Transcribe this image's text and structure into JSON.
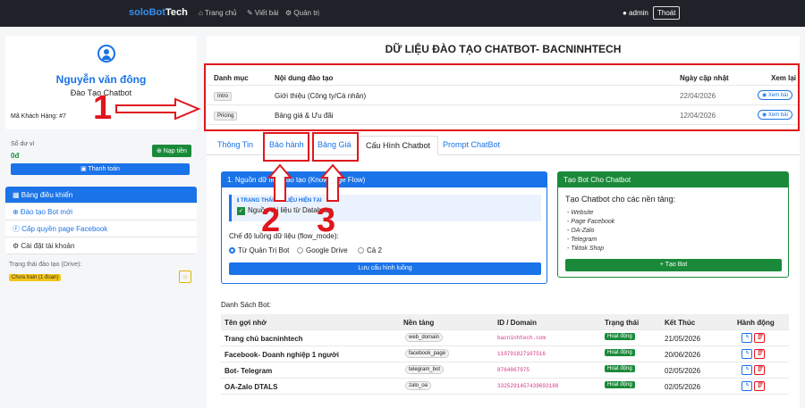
{
  "nav": {
    "logo_a": "soloBot",
    "logo_b": "Tech",
    "home": "⌂ Trang chủ",
    "posts": "✎ Viết bài",
    "admin": "⚙ Quản trị",
    "user": "● admin",
    "logout": "Thoát"
  },
  "profile": {
    "name": "Nguyễn văn đông",
    "role": "Đào Tạo Chatbot",
    "code": "Mã Khách Hàng: #7"
  },
  "balance": {
    "label": "Số dư ví",
    "value": "0đ",
    "topup": "⊕ Nạp tiền",
    "pay": "▣ Thanh toán"
  },
  "menu": [
    {
      "label": "▦ Bảng điều khiển"
    },
    {
      "label": "⊕ Đào tạo Bot mới"
    },
    {
      "label": "ⓕ Cấp quyền page Facebook"
    },
    {
      "label": "⚙ Cài đặt tài khoản"
    }
  ],
  "training": {
    "label": "Trạng thái đào tạo (Drive):",
    "badge": "Chưa train (1 đoạn)"
  },
  "main": {
    "title": "DỮ LIỆU ĐÀO TẠO CHATBOT- BACNINHTECH"
  },
  "train_table": {
    "headers": [
      "Danh mục",
      "Nội dung đào tạo",
      "Ngày cập nhật",
      "Xem lại"
    ],
    "rows": [
      {
        "tag": "Intro",
        "content": "Giới thiệu (Công ty/Cá nhân)",
        "date": "22/04/2026",
        "view": "◉ Xem bài"
      },
      {
        "tag": "Pricing",
        "content": "Bảng giá & Ưu đãi",
        "date": "12/04/2026",
        "view": "◉ Xem bài"
      }
    ]
  },
  "tabs": [
    "Thông Tin",
    "Bảo hành",
    "Bảng Giá",
    "Cấu Hình Chatbot",
    "Prompt ChatBot"
  ],
  "panel1": {
    "head": "1. Nguồn dữ liệu đào tạo (Knowledge Flow)",
    "status_title": "ℹ TRẠNG THÁI DỮ LIỆU HIỆN TẠI",
    "status_value": "Nguồn tài liệu từ Database",
    "mode_label": "Chế độ luồng dữ liệu (flow_mode):",
    "radios": [
      "Từ Quản Trị Bot",
      "Google Drive",
      "Cả 2"
    ],
    "save": "Lưu cấu hình luồng"
  },
  "panel2": {
    "head": "Tạo Bot Cho Chatbot",
    "title": "Tạo Chatbot cho các nền tảng:",
    "platforms": [
      "- Website",
      "- Page Facebook",
      "- OA-Zalo",
      "- Telegram",
      "- Tiktok Shop"
    ],
    "button": "+ Tạo Bot"
  },
  "bots": {
    "label": "Danh Sách Bot:",
    "headers": [
      "Tên gợi nhớ",
      "Nền tảng",
      "ID / Domain",
      "Trạng thái",
      "Kết Thúc",
      "Hành động"
    ],
    "rows": [
      {
        "name": "Trang chủ bacninhtech",
        "platform": "web_domain",
        "id": "bacninhtech.com",
        "status": "Hoạt động",
        "end": "21/05/2026"
      },
      {
        "name": "Facebook- Doanh nghiệp 1 người",
        "platform": "facebook_page",
        "id": "110791827107516",
        "status": "Hoạt động",
        "end": "20/06/2026"
      },
      {
        "name": "Bot- Telegram",
        "platform": "telegram_bot",
        "id": "8764867975",
        "status": "Hoạt động",
        "end": "02/05/2026"
      },
      {
        "name": "OA-Zalo DTALS",
        "platform": "zalo_oa",
        "id": "3325291457439693188",
        "status": "Hoạt động",
        "end": "02/05/2026"
      }
    ]
  },
  "annotations": [
    "1",
    "2",
    "3"
  ]
}
